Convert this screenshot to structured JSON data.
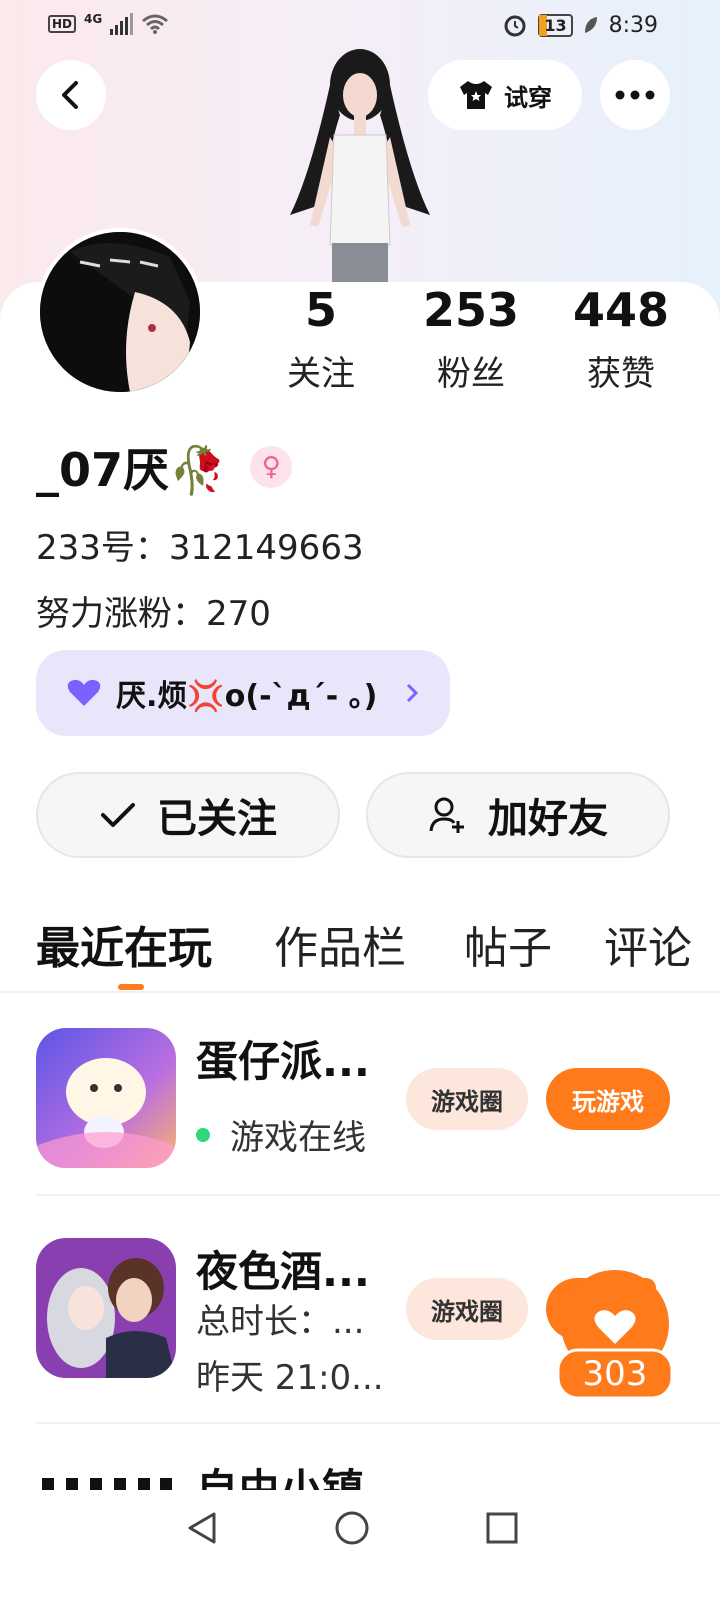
{
  "status_bar": {
    "hd_label": "HD",
    "network_label": "4G",
    "battery": "13",
    "time": "8:39"
  },
  "header": {
    "back_icon": "chevron-left-icon",
    "try_on_label": "试穿",
    "more_icon": "more-dots-icon"
  },
  "stats": [
    {
      "value": "5",
      "label": "关注"
    },
    {
      "value": "253",
      "label": "粉丝"
    },
    {
      "value": "448",
      "label": "获赞"
    }
  ],
  "profile": {
    "name": "_07厌🥀",
    "gender_icon": "female-icon",
    "id_line": "233号：312149663",
    "fans_goal_line": "努力涨粉：270",
    "signature": "厌.烦💢o(-`д´- 。)"
  },
  "actions": {
    "followed_label": "已关注",
    "add_friend_label": "加好友"
  },
  "tabs": [
    "最近在玩",
    "作品栏",
    "帖子",
    "评论"
  ],
  "games": [
    {
      "title": "蛋仔派...",
      "subtitle": "游戏在线",
      "circle_label": "游戏圈",
      "play_label": "玩游戏"
    },
    {
      "title": "夜色酒...",
      "subtitle1": "总时长：...",
      "subtitle2": "昨天 21:0...",
      "circle_label": "游戏圈"
    },
    {
      "title": "自由小镇"
    }
  ],
  "like_badge": {
    "count": "303"
  },
  "colors": {
    "accent": "#ff7a1a",
    "online": "#2fd67a",
    "signature_bg": "#e8e6fb"
  }
}
